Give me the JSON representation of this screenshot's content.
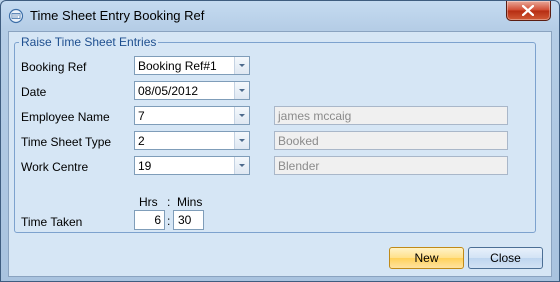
{
  "window": {
    "title": "Time Sheet Entry Booking Ref"
  },
  "group": {
    "title": "Raise Time Sheet Entries"
  },
  "fields": {
    "booking_ref": {
      "label": "Booking Ref",
      "value": "Booking Ref#1"
    },
    "date": {
      "label": "Date",
      "value": "08/05/2012"
    },
    "employee_name": {
      "label": "Employee Name",
      "value": "7",
      "lookup": "james mccaig"
    },
    "time_sheet_type": {
      "label": "Time Sheet Type",
      "value": "2",
      "lookup": "Booked"
    },
    "work_centre": {
      "label": "Work Centre",
      "value": "19",
      "lookup": "Blender"
    }
  },
  "time_taken": {
    "label": "Time Taken",
    "hrs_label": "Hrs",
    "separator": ":",
    "mins_label": "Mins",
    "hours": "6",
    "minutes": "30"
  },
  "buttons": {
    "new": "New",
    "close": "Close"
  }
}
